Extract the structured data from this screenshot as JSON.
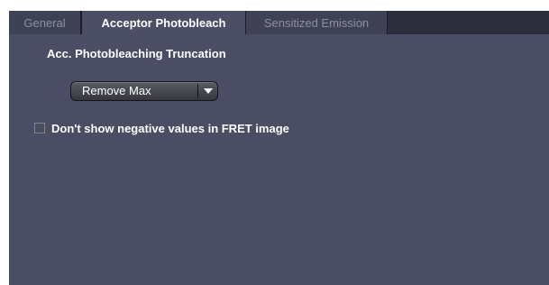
{
  "tabs": [
    {
      "label": "General",
      "active": false
    },
    {
      "label": "Acceptor Photobleach",
      "active": true
    },
    {
      "label": "Sensitized Emission",
      "active": false
    }
  ],
  "panel": {
    "section_title": "Acc. Photobleaching Truncation",
    "truncation_select": {
      "value": "Remove Max",
      "arrow_icon": "chevron-down-icon"
    },
    "negative_values_checkbox": {
      "label": "Don't show negative values in FRET image",
      "checked": false
    }
  },
  "colors": {
    "panel_bg": "#4a4d63",
    "tab_active_bg": "#4b4e64",
    "tab_inactive_bg": "#3f4254",
    "tabbar_bg": "#2c2e3c",
    "text": "#ffffff",
    "inactive_tab_text": "#8b8f9f"
  }
}
